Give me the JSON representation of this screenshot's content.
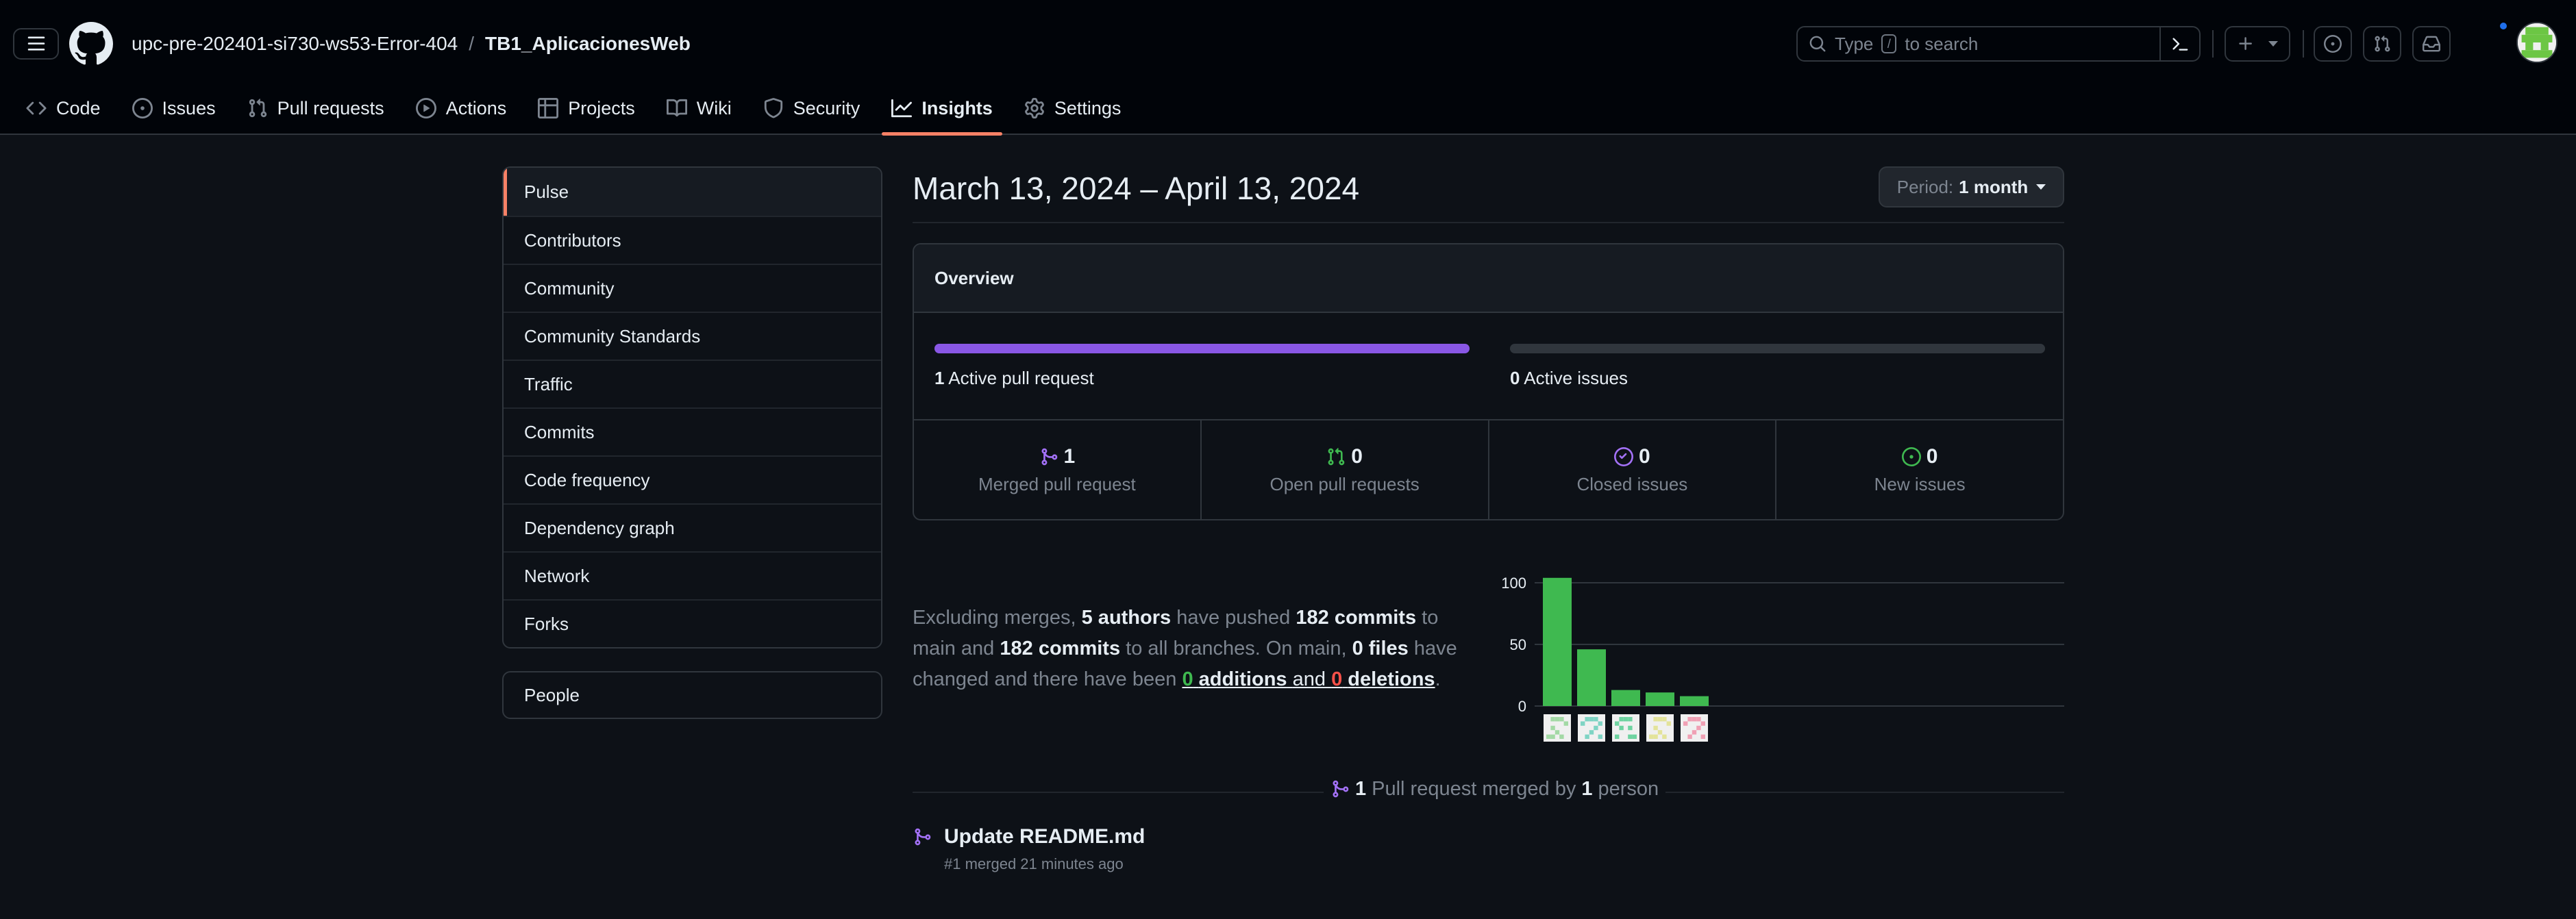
{
  "header": {
    "owner": "upc-pre-202401-si730-ws53-Error-404",
    "separator": "/",
    "repo": "TB1_AplicacionesWeb",
    "search_prefix": "Type",
    "search_key": "/",
    "search_suffix": "to search"
  },
  "tabs": [
    {
      "label": "Code",
      "icon": "code-icon"
    },
    {
      "label": "Issues",
      "icon": "issue-opened-icon"
    },
    {
      "label": "Pull requests",
      "icon": "git-pull-request-icon"
    },
    {
      "label": "Actions",
      "icon": "play-icon"
    },
    {
      "label": "Projects",
      "icon": "table-icon"
    },
    {
      "label": "Wiki",
      "icon": "book-icon"
    },
    {
      "label": "Security",
      "icon": "shield-icon"
    },
    {
      "label": "Insights",
      "icon": "graph-icon",
      "active": true
    },
    {
      "label": "Settings",
      "icon": "gear-icon"
    }
  ],
  "sidebar": {
    "items": [
      "Pulse",
      "Contributors",
      "Community",
      "Community Standards",
      "Traffic",
      "Commits",
      "Code frequency",
      "Dependency graph",
      "Network",
      "Forks"
    ],
    "selected": "Pulse",
    "people": "People"
  },
  "main": {
    "date_range": "March 13, 2024 – April 13, 2024",
    "period_label": "Period:",
    "period_value": "1 month",
    "overview": {
      "title": "Overview",
      "pull_requests": {
        "count": "1",
        "label": "Active pull request",
        "fill": 1.0
      },
      "issues": {
        "count": "0",
        "label": "Active issues",
        "fill": 0.0
      },
      "stats": [
        {
          "value": "1",
          "label": "Merged pull request",
          "icon": "git-merge-icon",
          "color": "#a371f7"
        },
        {
          "value": "0",
          "label": "Open pull requests",
          "icon": "git-pull-request-icon",
          "color": "#3fb950"
        },
        {
          "value": "0",
          "label": "Closed issues",
          "icon": "issue-closed-icon",
          "color": "#a371f7"
        },
        {
          "value": "0",
          "label": "New issues",
          "icon": "issue-opened-icon",
          "color": "#3fb950"
        }
      ]
    },
    "summary": {
      "t1": "Excluding merges,",
      "authors": "5 authors",
      "t2": "have pushed",
      "commits_main": "182 commits",
      "t3": "to main and",
      "commits_all": "182 commits",
      "t4": "to all branches. On main,",
      "files": "0 files",
      "t5": "have changed and there have been",
      "additions_n": "0",
      "additions_w": "additions",
      "and": "and",
      "deletions_n": "0",
      "deletions_w": "deletions",
      "period": "."
    },
    "merged_summary": {
      "count": "1",
      "t1": "Pull request merged by",
      "people": "1",
      "t2": "person"
    },
    "pr": {
      "title": "Update README.md",
      "meta": "#1 merged 21 minutes ago"
    }
  },
  "chart_data": {
    "type": "bar",
    "categories": [
      "author-1",
      "author-2",
      "author-3",
      "author-4",
      "author-5"
    ],
    "values": [
      104,
      46,
      13,
      11,
      8
    ],
    "ylim": [
      0,
      100
    ],
    "yticks": [
      100,
      50,
      0
    ],
    "color": "#3fb950",
    "grid": true,
    "avatar_colors": [
      "#a3d9a5",
      "#7fd4c4",
      "#6ed3a0",
      "#e3e39a",
      "#f0a0b4"
    ]
  }
}
